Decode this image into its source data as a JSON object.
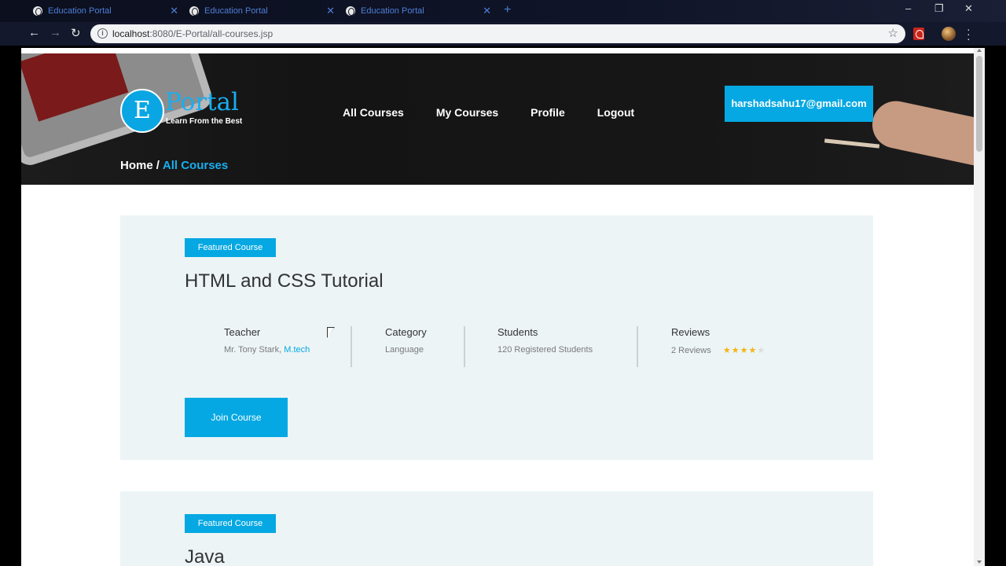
{
  "browser": {
    "tabs": [
      {
        "title": "Education Portal"
      },
      {
        "title": "Education Portal"
      },
      {
        "title": "Education Portal"
      }
    ],
    "new_tab": "+",
    "url_host": "localhost",
    "url_path": ":8080/E-Portal/all-courses.jsp",
    "controls": {
      "minimize": "–",
      "restore": "❐",
      "close": "✕"
    }
  },
  "site": {
    "logo_letter": "E",
    "logo_word": "Portal",
    "logo_tagline": "Learn From the Best",
    "nav": [
      "All Courses",
      "My Courses",
      "Profile",
      "Logout"
    ],
    "user_email": "harshadsahu17@gmail.com",
    "breadcrumb": {
      "home": "Home",
      "separator": "/",
      "current": "All Courses"
    }
  },
  "courses": [
    {
      "badge": "Featured Course",
      "title": "HTML and CSS Tutorial",
      "teacher_label": "Teacher",
      "teacher_name": "Mr. Tony Stark,",
      "teacher_degree": "M.tech",
      "category_label": "Category",
      "category_value": "Language",
      "students_label": "Students",
      "students_value": "120 Registered Students",
      "reviews_label": "Reviews",
      "reviews_value": "2 Reviews",
      "rating": 4,
      "rating_max": 5,
      "join_label": "Join Course"
    },
    {
      "badge": "Featured Course",
      "title": "Java"
    }
  ],
  "colors": {
    "accent": "#05a8e2",
    "card_bg": "#ecf4f6",
    "star": "#f3b411"
  }
}
